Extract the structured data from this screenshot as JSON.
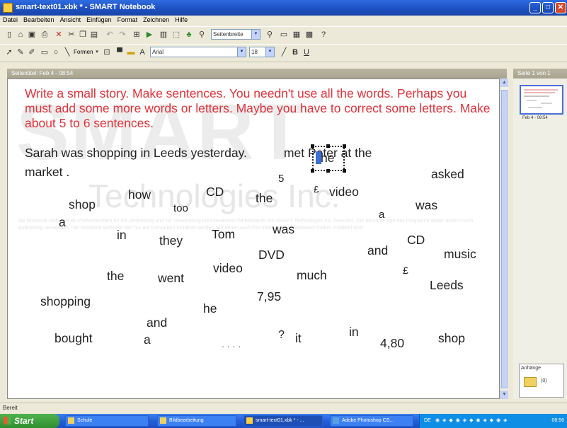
{
  "window": {
    "title": "smart-text01.xbk * - SMART Notebook",
    "minimize": "_",
    "maximize": "□",
    "close": "✕"
  },
  "menu": [
    "Datei",
    "Bearbeiten",
    "Ansicht",
    "Einfügen",
    "Format",
    "Zeichnen",
    "Hilfe"
  ],
  "toolbar": {
    "zoom_label": "Seitenbreite",
    "shapes_label": "Formen",
    "font_name": "Arial",
    "font_size": "18",
    "bold": "B",
    "underline": "U"
  },
  "page": {
    "header": "Seitentitel: Feb 4 - 08:54",
    "watermark_logo": "SMART",
    "watermark_sub": "Technologies Inc.",
    "watermark_text": "Die Notebook-Software ist urheberrechtlich für die Verbreitung und zur Verwendung mit Interaktiven Whiteboards von SMART Technologies Inc. lizenziert. Der Benutzer darf das Programm weder ändern noch anderweitig verwenden. Die Notebook-Software darf nur auf Computern installiert werden, auf denen auch Ihre interaktiven Whiteboard-Treiber installiert sind.",
    "instruction": "Write a small story. Make sentences. You needn't use all the words. Perhaps you must add some more words or letters. Maybe you have to correct some letters. Make about 5 to 6 sentences.",
    "sentence_line1": "Sarah  was  shopping  in  Leeds yesterday.",
    "sentence_met": "met  Peter  at  the",
    "sentence_line2": "market .",
    "selected_word": "he",
    "words": [
      {
        "id": "asked",
        "text": "asked"
      },
      {
        "id": "5",
        "text": "5"
      },
      {
        "id": "pound1",
        "text": "£"
      },
      {
        "id": "video1",
        "text": "video"
      },
      {
        "id": "shop1",
        "text": "shop"
      },
      {
        "id": "how",
        "text": "how"
      },
      {
        "id": "too",
        "text": "too"
      },
      {
        "id": "CD1",
        "text": "CD"
      },
      {
        "id": "the1",
        "text": "the"
      },
      {
        "id": "was1",
        "text": "was"
      },
      {
        "id": "a1",
        "text": "a"
      },
      {
        "id": "a2",
        "text": "a"
      },
      {
        "id": "in1",
        "text": "in"
      },
      {
        "id": "they",
        "text": "they"
      },
      {
        "id": "Tom",
        "text": "Tom"
      },
      {
        "id": "was2",
        "text": "was"
      },
      {
        "id": "CD2",
        "text": "CD"
      },
      {
        "id": "DVD",
        "text": "DVD"
      },
      {
        "id": "and1",
        "text": "and"
      },
      {
        "id": "music",
        "text": "music"
      },
      {
        "id": "the2",
        "text": "the"
      },
      {
        "id": "went",
        "text": "went"
      },
      {
        "id": "video2",
        "text": "video"
      },
      {
        "id": "much",
        "text": "much"
      },
      {
        "id": "pound2",
        "text": "£"
      },
      {
        "id": "Leeds",
        "text": "Leeds"
      },
      {
        "id": "shopping",
        "text": "shopping"
      },
      {
        "id": "he",
        "text": "he"
      },
      {
        "id": "795",
        "text": "7,95"
      },
      {
        "id": "and2",
        "text": "and"
      },
      {
        "id": "bought",
        "text": "bought"
      },
      {
        "id": "a3",
        "text": "a"
      },
      {
        "id": "dots",
        "text": ". .   . ."
      },
      {
        "id": "question",
        "text": "?"
      },
      {
        "id": "it",
        "text": "it"
      },
      {
        "id": "in2",
        "text": "in"
      },
      {
        "id": "480",
        "text": "4,80"
      },
      {
        "id": "shop2",
        "text": "shop"
      }
    ]
  },
  "sidebar": {
    "header": "Seite 1 von 1",
    "thumbnail_caption": "Feb 4 - 08:54",
    "attachments_label": "Anhänge",
    "attachments_count": "(0)"
  },
  "status": "Bereit",
  "taskbar": {
    "start": "Start",
    "tasks": [
      {
        "label": "Schule",
        "active": false
      },
      {
        "label": "Bildbearbeitung",
        "active": false
      },
      {
        "label": "smart-text01.xbk * - ...",
        "active": true
      },
      {
        "label": "Adobe Photoshop CS...",
        "active": false
      }
    ],
    "lang": "DE",
    "clock": "08:56"
  },
  "colors": {
    "instruction_text": "#e0323a",
    "title_bar": "#245edb",
    "selection": "#3a6fd8"
  }
}
